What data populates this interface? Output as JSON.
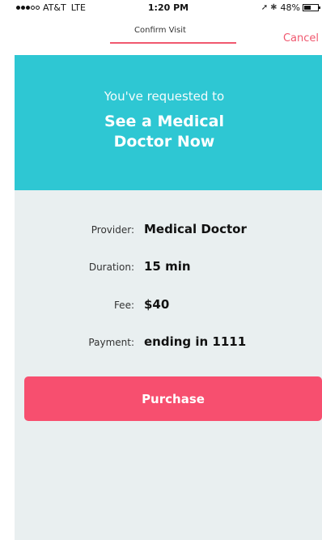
{
  "status_bar": {
    "carrier": "AT&T",
    "network": "LTE",
    "time": "1:20 PM",
    "battery": "48%",
    "battery_level": 0.48,
    "signal_full_dots": 3,
    "signal_empty_dots": 2
  },
  "nav": {
    "title": "Confirm Visit",
    "cancel_label": "Cancel"
  },
  "hero": {
    "subtitle": "You've requested to",
    "title_line1": "See a Medical",
    "title_line2": "Doctor Now"
  },
  "details": [
    {
      "label": "Provider:",
      "value": "Medical Doctor"
    },
    {
      "label": "Duration:",
      "value": "15 min"
    },
    {
      "label": "Fee:",
      "value": "$40"
    },
    {
      "label": "Payment:",
      "value": "ending in 1111"
    }
  ],
  "purchase_label": "Purchase",
  "colors": {
    "accent": "#f0586f",
    "hero": "#2ec7d3",
    "button": "#f74f6f",
    "background": "#e9eff0"
  },
  "icons": [
    "location-arrow-icon",
    "bluetooth-icon",
    "battery-icon",
    "signal-dots-icon"
  ]
}
